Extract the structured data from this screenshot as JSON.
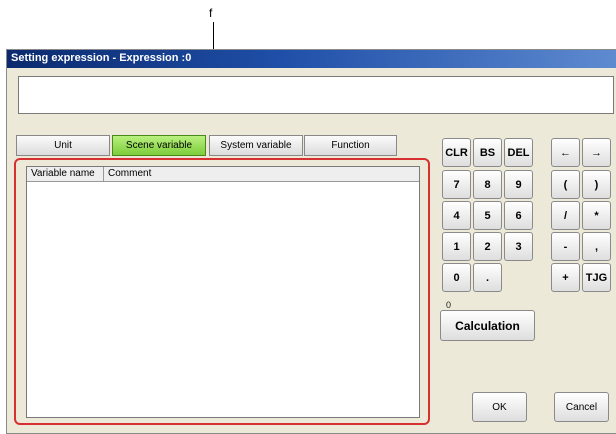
{
  "callout": {
    "label": "f"
  },
  "window": {
    "title": "Setting expression - Expression :0"
  },
  "expression": {
    "value": ""
  },
  "tabs": [
    {
      "label": "Unit",
      "active": false
    },
    {
      "label": "Scene variable",
      "active": true
    },
    {
      "label": "System variable",
      "active": false
    },
    {
      "label": "Function",
      "active": false
    }
  ],
  "list": {
    "columns": [
      "Variable name",
      "Comment"
    ],
    "rows": []
  },
  "keypad": {
    "clr": "CLR",
    "bs": "BS",
    "del": "DEL",
    "left_arrow": "←",
    "right_arrow": "→",
    "k7": "7",
    "k8": "8",
    "k9": "9",
    "lparen": "(",
    "rparen": ")",
    "k4": "4",
    "k5": "5",
    "k6": "6",
    "slash": "/",
    "star": "*",
    "k1": "1",
    "k2": "2",
    "k3": "3",
    "minus": "-",
    "comma": ",",
    "k0": "0",
    "dot": ".",
    "plus": "+",
    "tjg": "TJG"
  },
  "calculation": {
    "label": "Calculation",
    "result": "0"
  },
  "buttons": {
    "ok": "OK",
    "cancel": "Cancel"
  },
  "colors": {
    "active_tab": "#8fd94a",
    "highlight": "#d73030",
    "title_bar": "#1f4fa8"
  }
}
